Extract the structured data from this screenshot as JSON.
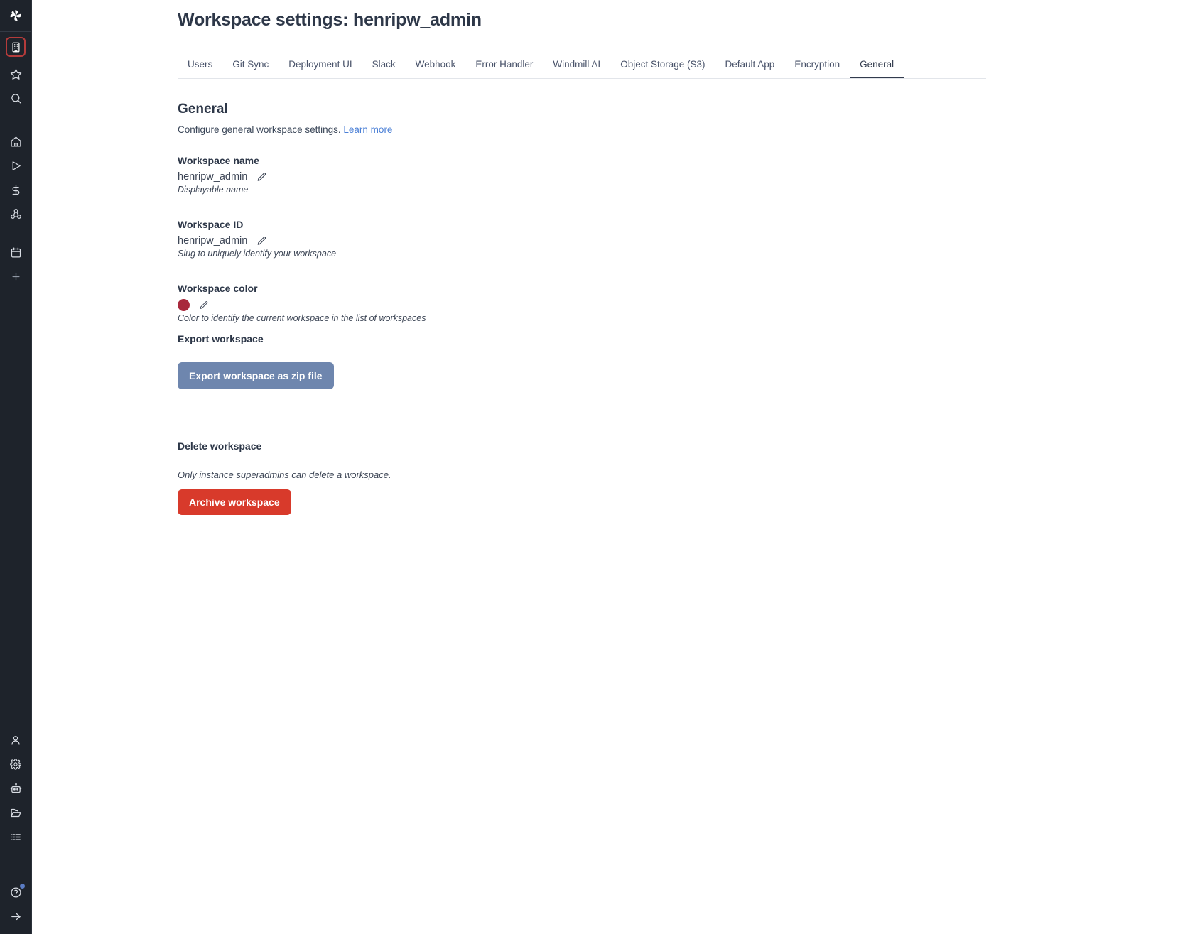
{
  "sidebar": {
    "logo": {
      "name": "windmill-logo"
    },
    "top_items": [
      {
        "name": "workspace-building-icon",
        "label": "Workspace",
        "active": true
      },
      {
        "name": "star-icon",
        "label": "Favorites",
        "active": false
      },
      {
        "name": "search-icon",
        "label": "Search",
        "active": false
      }
    ],
    "nav_items": [
      {
        "name": "home-icon",
        "label": "Home"
      },
      {
        "name": "runs-play-icon",
        "label": "Runs"
      },
      {
        "name": "variables-dollar-icon",
        "label": "Variables"
      },
      {
        "name": "resources-cube-icon",
        "label": "Resources"
      }
    ],
    "secondary_items": [
      {
        "name": "schedules-calendar-icon",
        "label": "Schedules"
      },
      {
        "name": "add-plus-icon",
        "label": "Add"
      }
    ],
    "bottom_items": [
      {
        "name": "user-icon",
        "label": "User"
      },
      {
        "name": "gear-icon",
        "label": "Settings"
      },
      {
        "name": "workers-robot-icon",
        "label": "Workers"
      },
      {
        "name": "folder-icon",
        "label": "Folders"
      },
      {
        "name": "list-icon",
        "label": "Audit logs"
      }
    ],
    "footer_items": [
      {
        "name": "help-question-icon",
        "label": "Help",
        "badge": true
      },
      {
        "name": "expand-arrow-icon",
        "label": "Expand sidebar",
        "badge": false
      }
    ]
  },
  "header": {
    "title": "Workspace settings: henripw_admin"
  },
  "tabs": [
    {
      "label": "Users",
      "active": false
    },
    {
      "label": "Git Sync",
      "active": false
    },
    {
      "label": "Deployment UI",
      "active": false
    },
    {
      "label": "Slack",
      "active": false
    },
    {
      "label": "Webhook",
      "active": false
    },
    {
      "label": "Error Handler",
      "active": false
    },
    {
      "label": "Windmill AI",
      "active": false
    },
    {
      "label": "Object Storage (S3)",
      "active": false
    },
    {
      "label": "Default App",
      "active": false
    },
    {
      "label": "Encryption",
      "active": false
    },
    {
      "label": "General",
      "active": true
    }
  ],
  "general": {
    "heading": "General",
    "subtitle": "Configure general workspace settings.",
    "learn_more": "Learn more",
    "workspace_name": {
      "label": "Workspace name",
      "value": "henripw_admin",
      "hint": "Displayable name"
    },
    "workspace_id": {
      "label": "Workspace ID",
      "value": "henripw_admin",
      "hint": "Slug to uniquely identify your workspace"
    },
    "workspace_color": {
      "label": "Workspace color",
      "value": "#a8293c",
      "hint": "Color to identify the current workspace in the list of workspaces"
    },
    "export": {
      "label": "Export workspace",
      "button": "Export workspace as zip file"
    },
    "delete": {
      "label": "Delete workspace",
      "hint": "Only instance superadmins can delete a workspace.",
      "button": "Archive workspace"
    }
  },
  "colors": {
    "sidebar_bg": "#1e232b",
    "active_outline": "#b43b3b",
    "export_button": "#6e86ae",
    "archive_button": "#d83a2b",
    "link": "#4a7fd6",
    "workspace_color": "#a8293c"
  }
}
